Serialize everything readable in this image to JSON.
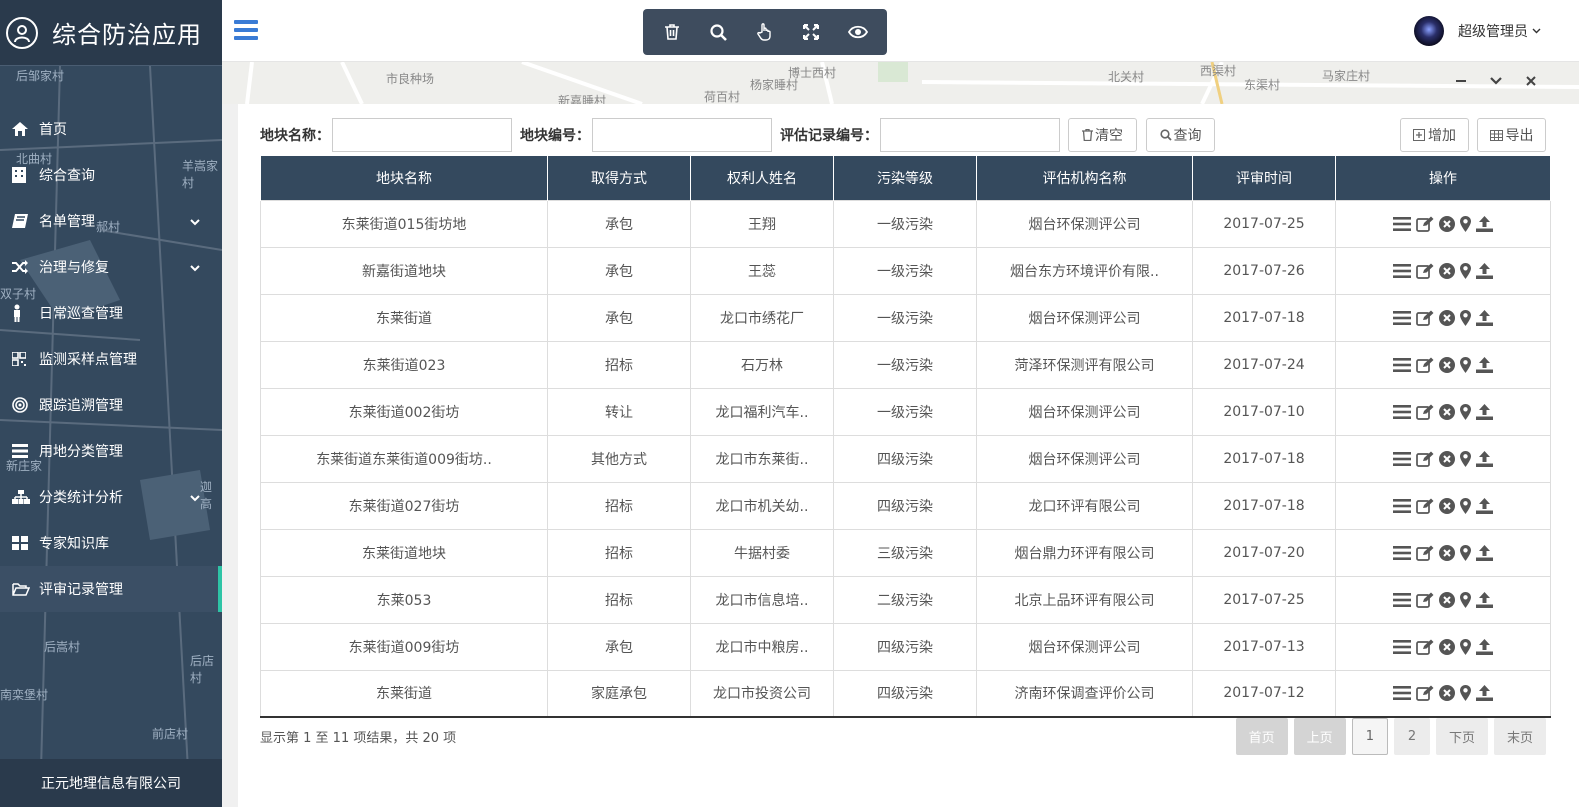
{
  "sidebar": {
    "title": "综合防治应用",
    "items": [
      {
        "label": "首页",
        "icon": "home-icon"
      },
      {
        "label": "综合查询",
        "icon": "building-icon"
      },
      {
        "label": "名单管理",
        "icon": "book-icon"
      },
      {
        "label": "治理与修复",
        "icon": "shuffle-icon"
      },
      {
        "label": "日常巡查管理",
        "icon": "person-icon"
      },
      {
        "label": "监测采样点管理",
        "icon": "qrcode-icon"
      },
      {
        "label": "跟踪追溯管理",
        "icon": "target-icon"
      },
      {
        "label": "用地分类管理",
        "icon": "list-icon"
      },
      {
        "label": "分类统计分析",
        "icon": "sitemap-icon"
      },
      {
        "label": "专家知识库",
        "icon": "grid-icon"
      },
      {
        "label": "评审记录管理",
        "icon": "folder-open-icon"
      }
    ],
    "map_labels": [
      "后邹家村",
      "北曲村",
      "羊嵩家村",
      "郝村",
      "双子村",
      "新庄家",
      "后嵩村",
      "后店村",
      "南栾堡村",
      "前店村",
      "迦高"
    ],
    "footer": "正元地理信息有限公司"
  },
  "header": {
    "user": "超级管理员"
  },
  "map_strip": {
    "labels": [
      "市良种场",
      "新嘉睡村",
      "博士西村",
      "杨家睡村",
      "荷百村",
      "北关村",
      "西渠村",
      "东渠村",
      "马家庄村"
    ]
  },
  "search": {
    "name_label": "地块名称：",
    "code_label": "地块编号：",
    "record_label": "评估记录编号：",
    "name_value": "",
    "code_value": "",
    "record_value": "",
    "clear_label": "清空",
    "query_label": "查询",
    "add_label": "增加",
    "export_label": "导出"
  },
  "table": {
    "headers": [
      "地块名称",
      "取得方式",
      "权利人姓名",
      "污染等级",
      "评估机构名称",
      "评审时间",
      "操作"
    ],
    "rows": [
      [
        "东莱街道015街坊地",
        "承包",
        "王翔",
        "一级污染",
        "烟台环保测评公司",
        "2017-07-25"
      ],
      [
        "新嘉街道地块",
        "承包",
        "王蕊",
        "一级污染",
        "烟台东方环境评价有限..",
        "2017-07-26"
      ],
      [
        "东莱街道",
        "承包",
        "龙口市绣花厂",
        "一级污染",
        "烟台环保测评公司",
        "2017-07-18"
      ],
      [
        "东莱街道023",
        "招标",
        "石万林",
        "一级污染",
        "菏泽环保测评有限公司",
        "2017-07-24"
      ],
      [
        "东莱街道002街坊",
        "转让",
        "龙口福利汽车..",
        "一级污染",
        "烟台环保测评公司",
        "2017-07-10"
      ],
      [
        "东莱街道东莱街道009街坊..",
        "其他方式",
        "龙口市东莱街..",
        "四级污染",
        "烟台环保测评公司",
        "2017-07-18"
      ],
      [
        "东莱街道027街坊",
        "招标",
        "龙口市机关幼..",
        "四级污染",
        "龙口环评有限公司",
        "2017-07-18"
      ],
      [
        "东莱街道地块",
        "招标",
        "牛据村委",
        "三级污染",
        "烟台鼎力环评有限公司",
        "2017-07-20"
      ],
      [
        "东莱053",
        "招标",
        "龙口市信息培..",
        "二级污染",
        "北京上品环评有限公司",
        "2017-07-25"
      ],
      [
        "东莱街道009街坊",
        "承包",
        "龙口市中粮房..",
        "四级污染",
        "烟台环保测评公司",
        "2017-07-13"
      ],
      [
        "东莱街道",
        "家庭承包",
        "龙口市投资公司",
        "四级污染",
        "济南环保调查评价公司",
        "2017-07-12"
      ]
    ]
  },
  "pagination": {
    "info": "显示第 1 至 11 项结果，共 20 项",
    "first": "首页",
    "prev": "上页",
    "pages": [
      "1",
      "2"
    ],
    "next": "下页",
    "last": "末页"
  },
  "colors": {
    "sidebar_bg": "#34495e",
    "header_row": "#34495e",
    "active_accent": "#2ec4a6",
    "hamburger": "#3a7bd5"
  }
}
